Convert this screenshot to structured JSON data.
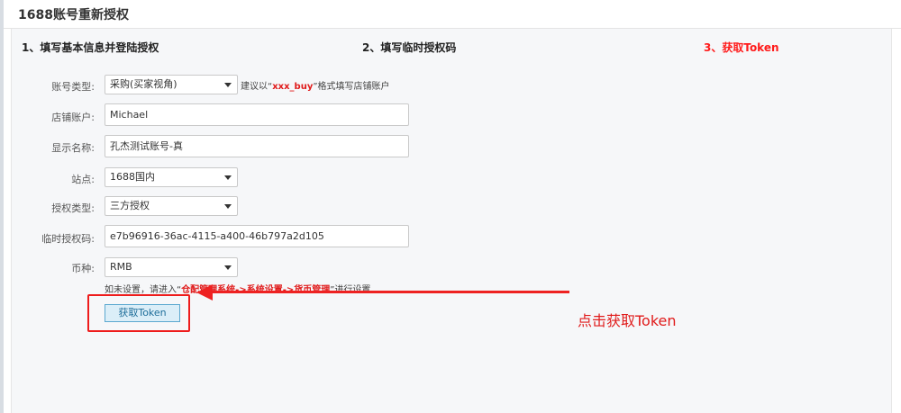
{
  "page": {
    "title": "1688账号重新授权"
  },
  "steps": [
    {
      "label": "1、填写基本信息并登陆授权"
    },
    {
      "label": "2、填写临时授权码"
    },
    {
      "label": "3、获取Token"
    }
  ],
  "form": {
    "account_type": {
      "label": "账号类型:",
      "value": "采购(买家视角)",
      "hint_pre": "建议以“",
      "hint_em": "xxx_buy",
      "hint_post": "”格式填写店铺账户"
    },
    "shop_account": {
      "label": "店铺账户:",
      "value": "Michael"
    },
    "display_name": {
      "label": "显示名称:",
      "value": "孔杰测试账号-真"
    },
    "site": {
      "label": "站点:",
      "value": "1688国内"
    },
    "auth_type": {
      "label": "授权类型:",
      "value": "三方授权"
    },
    "temp_code": {
      "label": "临时授权码:",
      "value": "e7b96916-36ac-4115-a400-46b797a2d105"
    },
    "currency": {
      "label": "币种:",
      "value": "RMB",
      "hint_pre": "如未设置，请进入“",
      "hint_em1": "仓配管理系统->系统设置->货币管理",
      "hint_post": "”进行设置"
    }
  },
  "actions": {
    "get_token_label": "获取Token"
  },
  "annotation": {
    "callout_text": "点击获取Token"
  },
  "colors": {
    "accent_red": "#e01b1b",
    "button_bg": "#dbeef8",
    "button_border": "#5ba8cf"
  }
}
